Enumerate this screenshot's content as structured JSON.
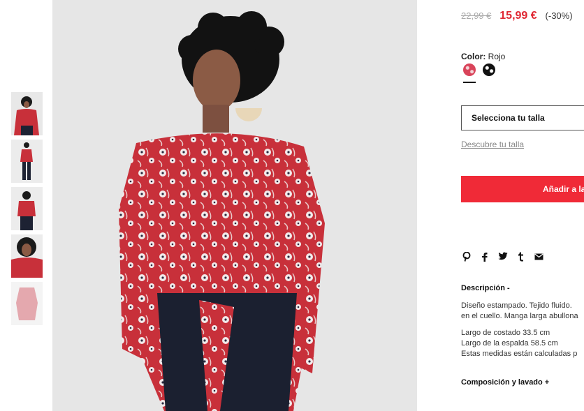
{
  "gallery": {
    "thumbnails": [
      {
        "label": "thumb-1",
        "variant": "front-closeup"
      },
      {
        "label": "thumb-2",
        "variant": "full-body"
      },
      {
        "label": "thumb-3",
        "variant": "back-view"
      },
      {
        "label": "thumb-4",
        "variant": "detail"
      },
      {
        "label": "thumb-5",
        "variant": "product-only"
      }
    ]
  },
  "product": {
    "price_old": "22,99 €",
    "price_new": "15,99 €",
    "discount": "(-30%)",
    "color_label": "Color:",
    "color_value": "Rojo",
    "swatches": [
      {
        "name": "rojo",
        "color": "#d9445a",
        "selected": true
      },
      {
        "name": "negro",
        "color": "#111111",
        "selected": false
      }
    ],
    "size_select_label": "Selecciona tu talla",
    "size_guide_link": "Descubre tu talla",
    "add_button_label": "Añadir a la",
    "share_icons": [
      "pinterest-icon",
      "facebook-icon",
      "twitter-icon",
      "tumblr-icon",
      "email-icon"
    ]
  },
  "description": {
    "title": "Descripción -",
    "text_line1": "Diseño estampado. Tejido fluido.",
    "text_line2": "en el cuello. Manga larga abullona",
    "measure_line1": "Largo de costado 33.5 cm",
    "measure_line2": "Largo de la espalda 58.5 cm",
    "measure_line3": "Estas medidas están calculadas p",
    "composition_title": "Composición y lavado +"
  },
  "colors": {
    "accent": "#f02a37",
    "price_red": "#e02833",
    "blouse_red": "#c8303a"
  }
}
